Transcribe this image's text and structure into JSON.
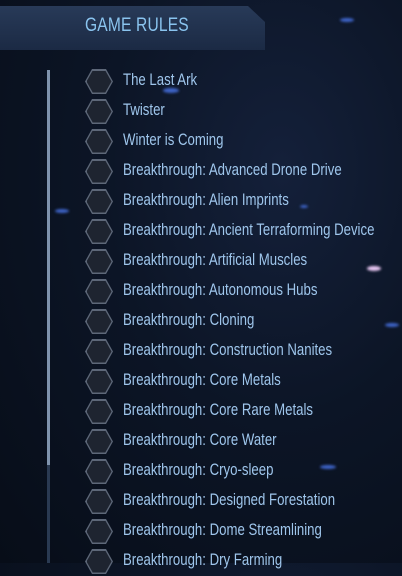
{
  "header": {
    "title": "GAME RULES"
  },
  "rules": [
    {
      "label": "The Last Ark",
      "icon": "hexagon-icon"
    },
    {
      "label": "Twister",
      "icon": "hexagon-icon"
    },
    {
      "label": "Winter is Coming",
      "icon": "hexagon-icon"
    },
    {
      "label": "Breakthrough: Advanced Drone Drive",
      "icon": "hexagon-icon"
    },
    {
      "label": "Breakthrough: Alien Imprints",
      "icon": "hexagon-icon"
    },
    {
      "label": "Breakthrough: Ancient Terraforming Device",
      "icon": "hexagon-icon"
    },
    {
      "label": "Breakthrough: Artificial Muscles",
      "icon": "hexagon-icon"
    },
    {
      "label": "Breakthrough: Autonomous Hubs",
      "icon": "hexagon-icon"
    },
    {
      "label": "Breakthrough: Cloning",
      "icon": "hexagon-icon"
    },
    {
      "label": "Breakthrough: Construction Nanites",
      "icon": "hexagon-icon"
    },
    {
      "label": "Breakthrough: Core Metals",
      "icon": "hexagon-icon"
    },
    {
      "label": "Breakthrough: Core Rare Metals",
      "icon": "hexagon-icon"
    },
    {
      "label": "Breakthrough: Core Water",
      "icon": "hexagon-icon"
    },
    {
      "label": "Breakthrough: Cryo-sleep",
      "icon": "hexagon-icon"
    },
    {
      "label": "Breakthrough: Designed Forestation",
      "icon": "hexagon-icon"
    },
    {
      "label": "Breakthrough: Dome Streamlining",
      "icon": "hexagon-icon"
    },
    {
      "label": "Breakthrough: Dry Farming",
      "icon": "hexagon-icon"
    }
  ],
  "colors": {
    "title": "#8ac4ef",
    "label": "#9fc6ec",
    "header_bg": "#1b2a44",
    "background": "#0c1526"
  }
}
